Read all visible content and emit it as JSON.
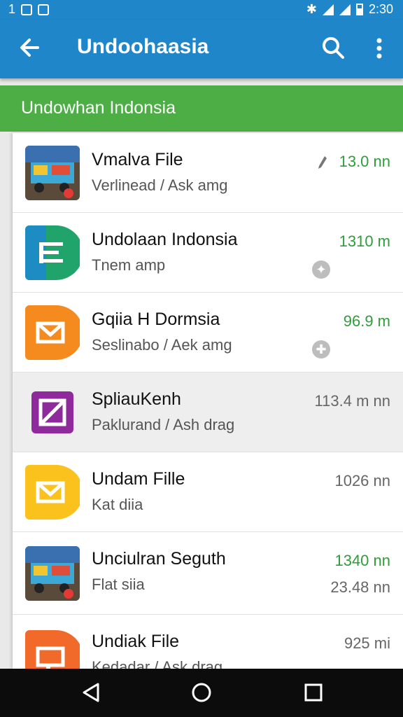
{
  "status": {
    "left_num": "1",
    "time": "2:30"
  },
  "appbar": {
    "title": "Undoohaasia",
    "back_icon": "arrow-back-icon",
    "search_icon": "search-icon",
    "more_icon": "more-vert-icon"
  },
  "banner": {
    "text": "Undowhan Indonsia"
  },
  "files": [
    {
      "name": "Vmalva File",
      "sub": "Verlinead / Ask amg",
      "size": "13.0 nn",
      "size_color": "#2e9d3a",
      "icon": "truck-thumbnail"
    },
    {
      "name": "Undolaan Indonsia",
      "sub": "Tnem amp",
      "size": "1310 m",
      "size_color": "#2e9d3a",
      "icon": "green-document-icon"
    },
    {
      "name": "Gqiia H Dormsia",
      "sub": "Seslinabo / Aek amg",
      "size": "96.9 m",
      "size_color": "#2e9d3a",
      "icon": "orange-mail-icon"
    },
    {
      "name": "SpliauKenh",
      "sub": "Paklurand / Ash drag",
      "size": "113.4 m nn",
      "size_color": "#666666",
      "icon": "purple-image-icon"
    },
    {
      "name": "Undam Fille",
      "sub": "Kat diia",
      "size": "1026 nn",
      "size_color": "#666666",
      "icon": "yellow-mail-icon"
    },
    {
      "name": "Unciulran Seguth",
      "sub": "Flat siia",
      "size": "1340 nn",
      "size2": "23.48 nn",
      "size_color": "#2e9d3a",
      "icon": "truck-thumbnail"
    },
    {
      "name": "Undiak File",
      "sub": "Kedadar / Ask drag",
      "size": "925 mi",
      "size_color": "#666666",
      "icon": "orange-slides-icon"
    }
  ],
  "nav": {
    "back": "nav-back-icon",
    "home": "nav-home-icon",
    "recents": "nav-recents-icon"
  }
}
